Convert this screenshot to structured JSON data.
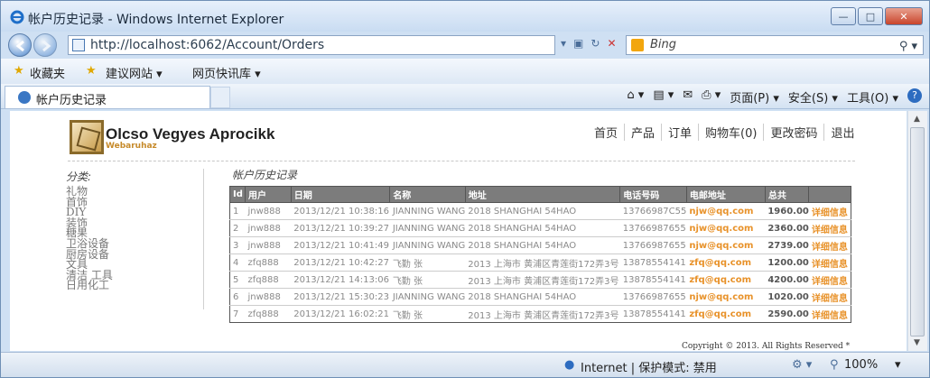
{
  "window": {
    "title": "帐户历史记录 - Windows Internet Explorer",
    "min": "—",
    "max": "□",
    "close": "✕"
  },
  "address": {
    "url": "http://localhost:6062/Account/Orders",
    "search_placeholder": "Bing"
  },
  "favorites": {
    "fav": "收藏夹",
    "suggested": "建议网站 ▾",
    "gallery": "网页快讯库 ▾"
  },
  "tab": {
    "label": "帐户历史记录"
  },
  "commands": {
    "page": "页面(P) ▾",
    "safety": "安全(S) ▾",
    "tools": "工具(O) ▾",
    "help": "?"
  },
  "site": {
    "brand": "Olcso Vegyes Aprocikk",
    "brand_sub": "Webaruhaz",
    "nav": [
      "首页",
      "产品",
      "订单",
      "购物车(0)",
      "更改密码",
      "退出"
    ],
    "category_title": "分类:",
    "categories": [
      "礼物",
      "首饰",
      "DIY",
      "装饰",
      "糖果",
      "卫浴设备",
      "厨房设备",
      "文具",
      "清洁 工具",
      "日用化工"
    ],
    "page_title": "帐户历史记录",
    "columns": [
      "Id",
      "用户",
      "日期",
      "名称",
      "地址",
      "电话号码",
      "电邮地址",
      "总共",
      ""
    ],
    "orders": [
      {
        "id": "1",
        "user": "jnw888",
        "date": "2013/12/21 10:38:16",
        "name": "JIANNING WANG",
        "addr": "2018 SHANGHAI 54HAO",
        "phone": "13766987C55",
        "email": "njw@qq.com",
        "total": "1960.00",
        "detail": "详细信息"
      },
      {
        "id": "2",
        "user": "jnw888",
        "date": "2013/12/21 10:39:27",
        "name": "JIANNING WANG",
        "addr": "2018 SHANGHAI 54HAO",
        "phone": "13766987655",
        "email": "njw@qq.com",
        "total": "2360.00",
        "detail": "详细信息"
      },
      {
        "id": "3",
        "user": "jnw888",
        "date": "2013/12/21 10:41:49",
        "name": "JIANNING WANG",
        "addr": "2018 SHANGHAI 54HAO",
        "phone": "13766987655",
        "email": "njw@qq.com",
        "total": "2739.00",
        "detail": "详细信息"
      },
      {
        "id": "4",
        "user": "zfq888",
        "date": "2013/12/21 10:42:27",
        "name": "飞勤 张",
        "addr": "2013 上海市 黄浦区青莲街172弄3号",
        "phone": "13878554141",
        "email": "zfq@qq.com",
        "total": "1200.00",
        "detail": "详细信息"
      },
      {
        "id": "5",
        "user": "zfq888",
        "date": "2013/12/21 14:13:06",
        "name": "飞勤 张",
        "addr": "2013 上海市 黄浦区青莲街172弄3号",
        "phone": "13878554141",
        "email": "zfq@qq.com",
        "total": "4200.00",
        "detail": "详细信息"
      },
      {
        "id": "6",
        "user": "jnw888",
        "date": "2013/12/21 15:30:23",
        "name": "JIANNING WANG",
        "addr": "2018 SHANGHAI 54HAO",
        "phone": "13766987655",
        "email": "njw@qq.com",
        "total": "1020.00",
        "detail": "详细信息"
      },
      {
        "id": "7",
        "user": "zfq888",
        "date": "2013/12/21 16:02:21",
        "name": "飞勤 张",
        "addr": "2013 上海市 黄浦区青莲街172弄3号",
        "phone": "13878554141",
        "email": "zfq@qq.com",
        "total": "2590.00",
        "detail": "详细信息"
      }
    ],
    "copyright": "Copyright © 2013. All Rights Reserved *"
  },
  "status": {
    "zone": "Internet | 保护模式: 禁用",
    "zoom": "100%"
  }
}
